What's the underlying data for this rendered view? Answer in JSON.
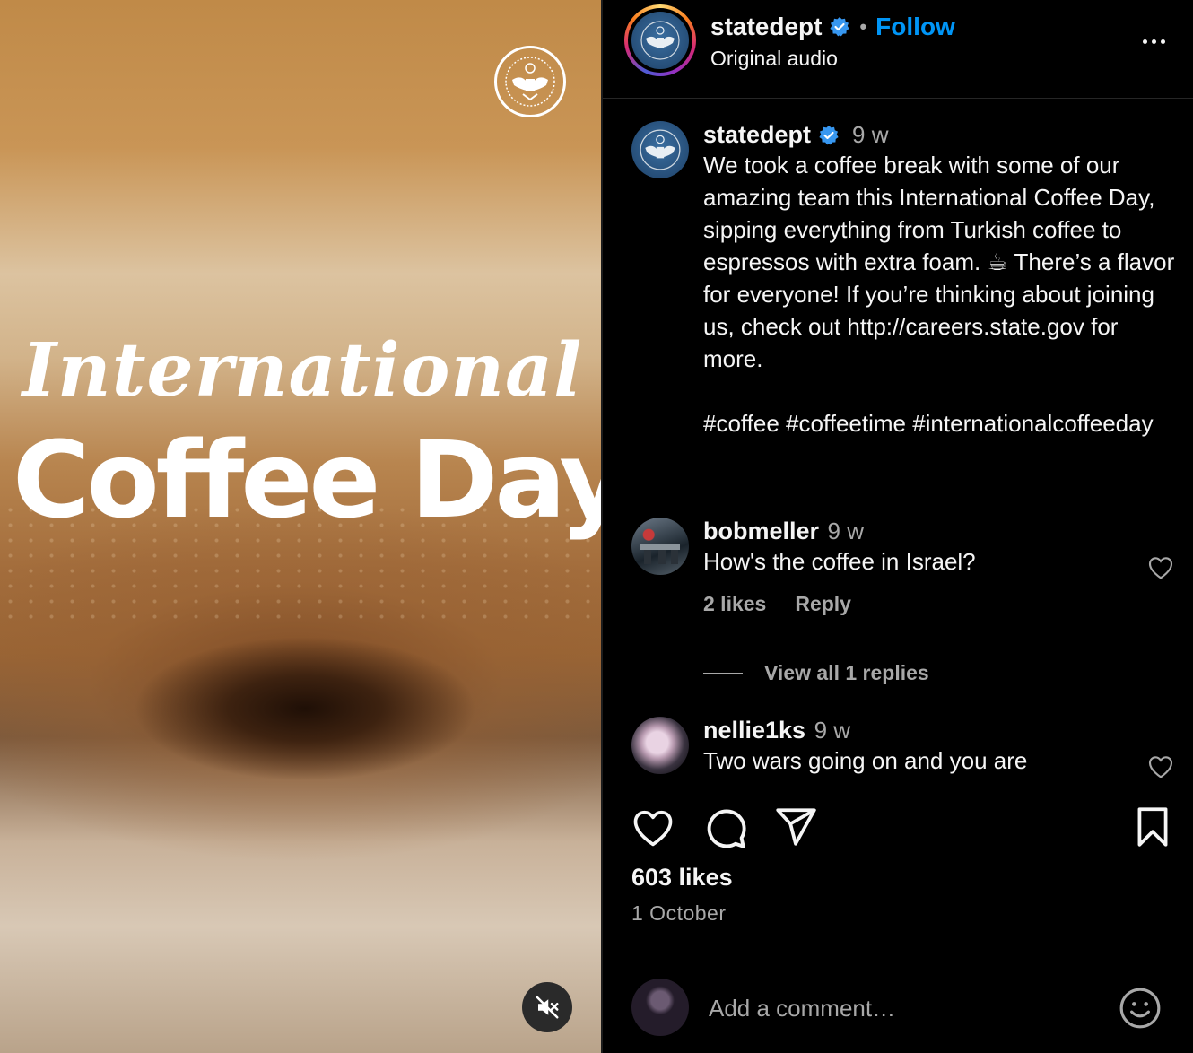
{
  "media": {
    "headline_line1": "International",
    "headline_line2": "Coffee Day"
  },
  "header": {
    "username": "statedept",
    "separator": "•",
    "follow_label": "Follow",
    "audio": "Original audio"
  },
  "caption": {
    "username": "statedept",
    "time": "9 w",
    "text": "We took a coffee break with some of our amazing team this International Coffee Day, sipping everything from Turkish coffee to espressos with extra foam. ☕ There’s a flavor for everyone! If you’re thinking about joining us, check out http://careers.state.gov for more.",
    "hashtags": "#coffee #coffeetime #internationalcoffeeday"
  },
  "comments": [
    {
      "username": "bobmeller",
      "time": "9 w",
      "text": "How's the coffee in Israel?",
      "likes": "2 likes",
      "reply_label": "Reply",
      "view_replies": "View all 1 replies"
    },
    {
      "username": "nellie1ks",
      "time": "9 w",
      "text": "Two wars going on and you are"
    }
  ],
  "actions": {
    "likes": "603 likes",
    "date": "1 October"
  },
  "composer": {
    "placeholder": "Add a comment…"
  },
  "icons": {
    "like": "heart-icon",
    "comment": "comment-icon",
    "share": "send-icon",
    "save": "bookmark-icon",
    "mute": "muted-speaker-icon",
    "verified": "verified-badge-icon",
    "more": "more-options-icon",
    "emoji": "emoji-icon"
  },
  "colors": {
    "background": "#000000",
    "text": "#f5f5f5",
    "secondary": "#a8a8a8",
    "follow": "#0095f6",
    "verified": "#3797f0"
  }
}
